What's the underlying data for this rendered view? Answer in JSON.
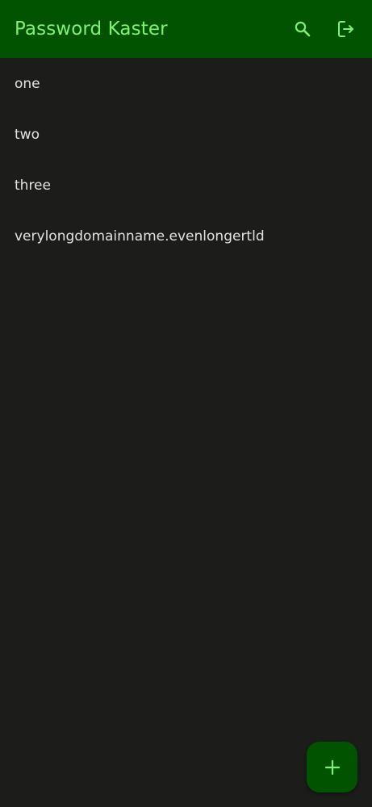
{
  "app_bar": {
    "title": "Password Kaster",
    "actions": [
      {
        "icon": "search-icon"
      },
      {
        "icon": "logout-icon"
      }
    ]
  },
  "list": {
    "items": [
      {
        "label": "one"
      },
      {
        "label": "two"
      },
      {
        "label": "three"
      },
      {
        "label": "verylongdomainname.evenlongertld"
      }
    ]
  },
  "fab": {
    "icon": "plus-icon"
  },
  "colors": {
    "background": "#1c1d1b",
    "app_bar": "#025300",
    "accent": "#7ef270",
    "text": "#e3e3df"
  }
}
